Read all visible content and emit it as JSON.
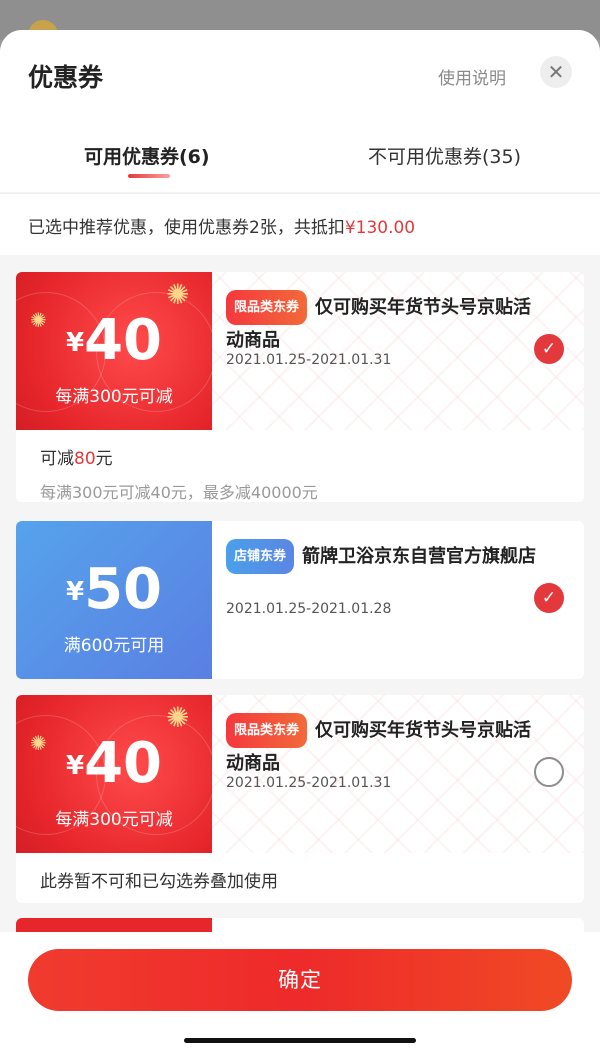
{
  "header": {
    "title": "优惠券",
    "help_label": "使用说明",
    "close_glyph": "✕"
  },
  "tabs": [
    {
      "label": "可用优惠券(6)",
      "active": true
    },
    {
      "label": "不可用优惠券(35)",
      "active": false
    }
  ],
  "summary": {
    "text": "已选中推荐优惠，使用优惠券2张，共抵扣",
    "amount": "¥130.00"
  },
  "coupons": [
    {
      "theme": "red",
      "currency": "¥",
      "amount": "40",
      "condition": "每满300元可减",
      "badge": "限品类东券",
      "title": "仅可购买年货节头号京贴活动商品",
      "date": "2021.01.25-2021.01.31",
      "selected": true,
      "foot_prefix": "可减",
      "foot_value": "80",
      "foot_suffix": "元",
      "foot_detail": "每满300元可减40元，最多减40000元"
    },
    {
      "theme": "blue",
      "currency": "¥",
      "amount": "50",
      "condition": "满600元可用",
      "badge": "店铺东券",
      "title": "箭牌卫浴京东自营官方旗舰店",
      "date": "2021.01.25-2021.01.28",
      "selected": true
    },
    {
      "theme": "red",
      "currency": "¥",
      "amount": "40",
      "condition": "每满300元可减",
      "badge": "限品类东券",
      "title": "仅可购买年货节头号京贴活动商品",
      "date": "2021.01.25-2021.01.31",
      "selected": false,
      "note": "此券暂不可和已勾选券叠加使用"
    }
  ],
  "check_glyph": "✓",
  "confirm_label": "确定",
  "colors": {
    "accent": "#e4393c",
    "blue": "#5a8ee6"
  }
}
